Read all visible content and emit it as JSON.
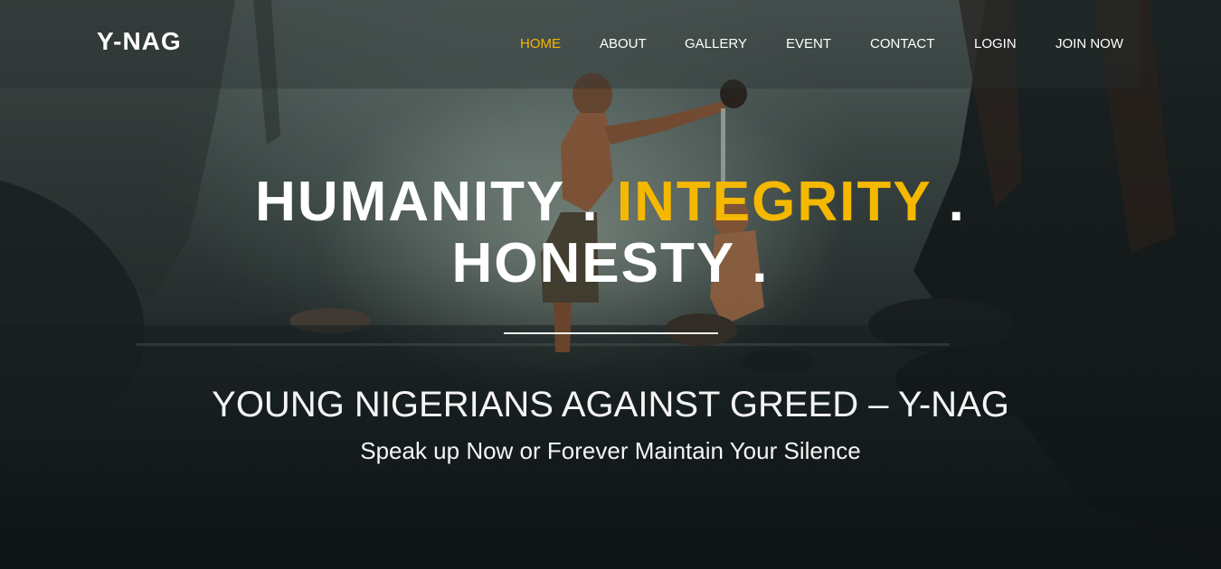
{
  "brand": {
    "logo": "Y-NAG"
  },
  "nav": {
    "items": [
      {
        "label": "HOME",
        "active": true
      },
      {
        "label": "ABOUT",
        "active": false
      },
      {
        "label": "GALLERY",
        "active": false
      },
      {
        "label": "EVENT",
        "active": false
      },
      {
        "label": "CONTACT",
        "active": false
      },
      {
        "label": "LOGIN",
        "active": false
      },
      {
        "label": "JOIN NOW",
        "active": false
      }
    ]
  },
  "hero": {
    "headline": {
      "word1": "HUMANITY . ",
      "word2": "INTEGRITY",
      "sep2": " .",
      "word3": "HONESTY ."
    },
    "subtitle": "YOUNG NIGERIANS AGAINST GREED – Y-NAG",
    "tagline": "Speak up Now or Forever Maintain Your Silence"
  },
  "colors": {
    "accent": "#f5b800",
    "text": "#ffffff",
    "nav_background": "rgba(40,48,48,0.38)"
  }
}
